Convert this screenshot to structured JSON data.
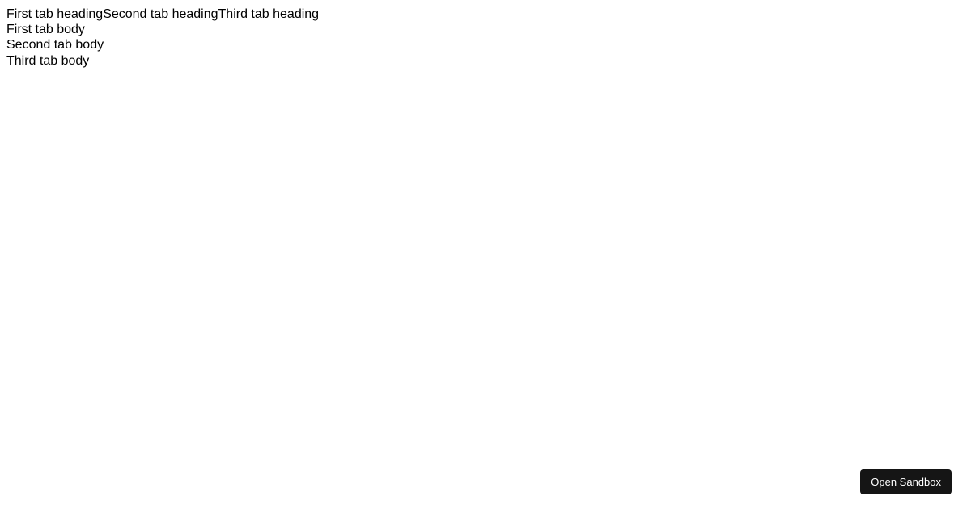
{
  "tabs": {
    "headings": [
      "First tab heading",
      "Second tab heading",
      "Third tab heading"
    ],
    "bodies": [
      "First tab body",
      "Second tab body",
      "Third tab body"
    ]
  },
  "footer": {
    "open_sandbox_label": "Open Sandbox"
  }
}
